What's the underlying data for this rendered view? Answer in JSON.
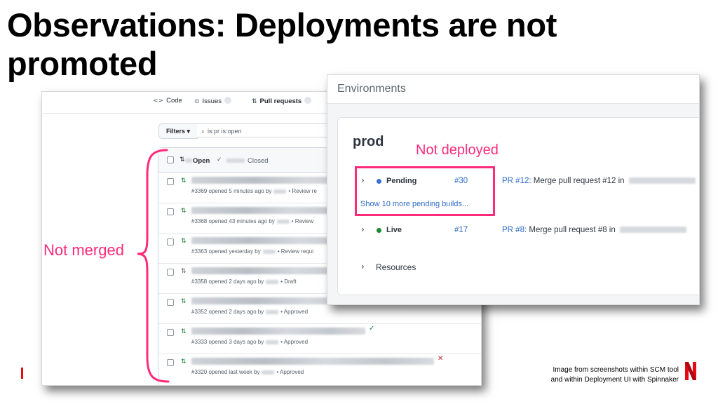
{
  "slide": {
    "title": "Observations: Deployments are not promoted",
    "annotation_left": "Not merged",
    "annotation_right": "Not deployed",
    "footnote_line1": "Image from screenshots within SCM tool",
    "footnote_line2": "and within Deployment UI with Spinnaker"
  },
  "github": {
    "tabs": [
      {
        "icon": "code-icon",
        "label": "Code"
      },
      {
        "icon": "issue-icon",
        "label": "Issues"
      },
      {
        "icon": "pull-request-icon",
        "label": "Pull requests"
      }
    ],
    "filters_label": "Filters ▾",
    "search_value": "is:pr is:open",
    "list_header": {
      "open_label": "Open",
      "closed_label": "Closed"
    },
    "rows": [
      {
        "meta_a": "#3369 opened 5 minutes ago by",
        "meta_b": "• Review re",
        "icon": "open-pr-icon",
        "status": ""
      },
      {
        "meta_a": "#3368 opened 43 minutes ago by",
        "meta_b": "• Review",
        "icon": "open-pr-icon",
        "status": ""
      },
      {
        "meta_a": "#3363 opened yesterday by",
        "meta_b": "• Review requi",
        "icon": "open-pr-icon",
        "status": ""
      },
      {
        "meta_a": "#3358 opened 2 days ago by",
        "meta_b": "• Draft",
        "icon": "draft-pr-icon",
        "status": ""
      },
      {
        "meta_a": "#3352 opened 2 days ago by",
        "meta_b": "• Approved",
        "icon": "open-pr-icon",
        "status": ""
      },
      {
        "meta_a": "#3333 opened 3 days ago by",
        "meta_b": "• Approved",
        "icon": "open-pr-icon",
        "status": "check"
      },
      {
        "meta_a": "#3320 opened last week by",
        "meta_b": "• Approved",
        "icon": "open-pr-icon",
        "status": "fail"
      }
    ]
  },
  "spinnaker": {
    "header_title": "Environments",
    "environment": "prod",
    "pending": {
      "label": "Pending",
      "build": "#30",
      "pr_link": "PR #12:",
      "pr_text": "Merge pull request #12 in"
    },
    "more_builds": "Show 10 more pending builds...",
    "live": {
      "label": "Live",
      "build": "#17",
      "pr_link": "PR #8:",
      "pr_text": "Merge pull request #8 in"
    },
    "resources_label": "Resources"
  },
  "colors": {
    "annotation": "#ff2a7a",
    "pending_dot": "#3b6fd8",
    "live_dot": "#1a8a2e",
    "link": "#2d6bc4",
    "netflix_red": "#e50914"
  }
}
